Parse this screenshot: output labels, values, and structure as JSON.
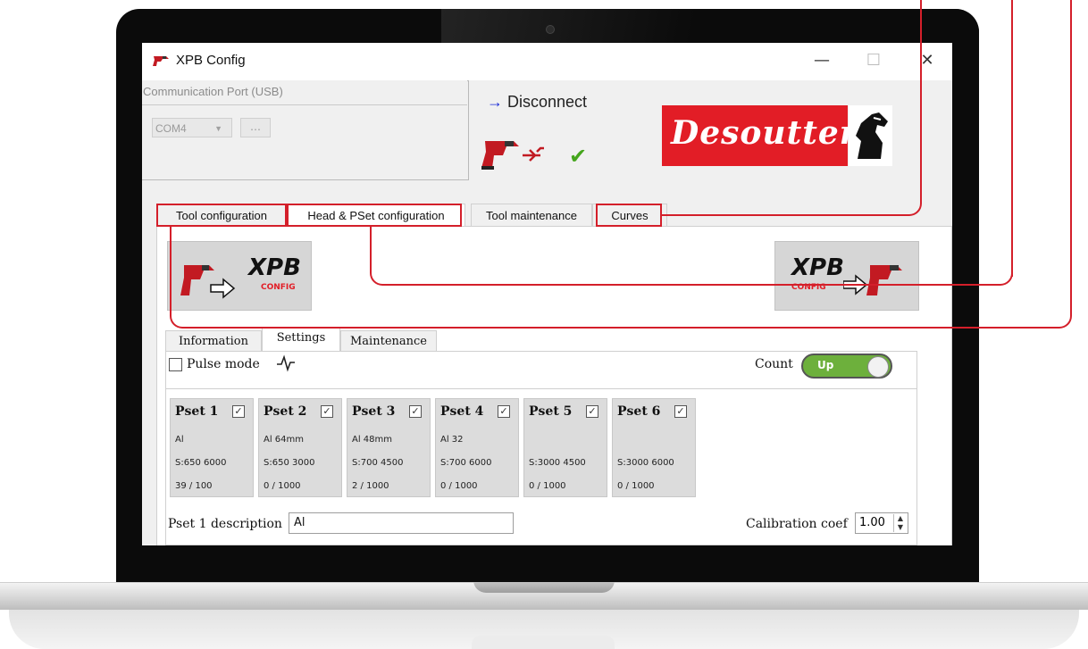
{
  "window": {
    "title": "XPB Config",
    "minimize": "—",
    "maximize": "☐",
    "close": "✕"
  },
  "comm": {
    "group_label": "Communication Port (USB)",
    "port_value": "COM4",
    "browse_label": "…"
  },
  "connection": {
    "arrow": "→",
    "action_label": "Disconnect",
    "status_mark": "✔"
  },
  "brand": {
    "name": "Desoutter"
  },
  "tabs": [
    {
      "label": "Tool configuration"
    },
    {
      "label": "Head & PSet configuration"
    },
    {
      "label": "Tool maintenance"
    },
    {
      "label": "Curves"
    }
  ],
  "transfer": {
    "read": {
      "title": "XPB",
      "sub": "CONFIG"
    },
    "write": {
      "title": "XPB",
      "sub": "CONFIG"
    }
  },
  "subtabs": [
    {
      "label": "Information"
    },
    {
      "label": "Settings"
    },
    {
      "label": "Maintenance"
    }
  ],
  "settings": {
    "pulse_mode_label": "Pulse mode",
    "pulse_mode_checked": false,
    "count_label": "Count",
    "count_value": "Up"
  },
  "psets": [
    {
      "name": "Pset 1",
      "checked": true,
      "material": "Al",
      "speed": "S:650 6000",
      "count": "39 / 100"
    },
    {
      "name": "Pset 2",
      "checked": true,
      "material": "Al 64mm",
      "speed": "S:650 3000",
      "count": "0 / 1000"
    },
    {
      "name": "Pset 3",
      "checked": true,
      "material": "Al 48mm",
      "speed": "S:700 4500",
      "count": "2 / 1000"
    },
    {
      "name": "Pset 4",
      "checked": true,
      "material": "Al 32",
      "speed": "S:700 6000",
      "count": "0 / 1000"
    },
    {
      "name": "Pset 5",
      "checked": true,
      "material": "",
      "speed": "S:3000 4500",
      "count": "0 / 1000"
    },
    {
      "name": "Pset 6",
      "checked": true,
      "material": "",
      "speed": "S:3000 6000",
      "count": "0 / 1000"
    }
  ],
  "description": {
    "label": "Pset 1 description",
    "value": "Al"
  },
  "calibration": {
    "label": "Calibration coef",
    "value": "1.00"
  },
  "colors": {
    "accent_red": "#d41f2a",
    "brand_red": "#e21d26",
    "toggle_green": "#6db03c",
    "link_blue": "#1a2bd6"
  }
}
